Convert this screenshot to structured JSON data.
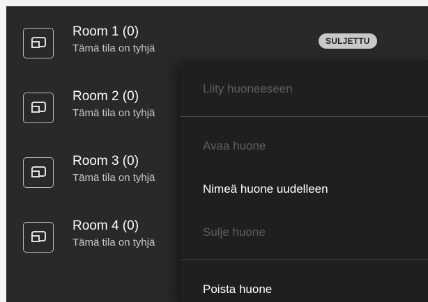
{
  "rooms": [
    {
      "name": "Room 1 (0)",
      "subtitle": "Tämä tila on tyhjä",
      "badge": "SULJETTU"
    },
    {
      "name": "Room 2 (0)",
      "subtitle": "Tämä tila on tyhjä"
    },
    {
      "name": "Room 3 (0)",
      "subtitle": "Tämä tila on tyhjä"
    },
    {
      "name": "Room 4 (0)",
      "subtitle": "Tämä tila on tyhjä"
    }
  ],
  "room_icon": "room-window-icon",
  "context_menu": {
    "items": [
      {
        "label": "Liity huoneeseen",
        "enabled": false
      },
      {
        "label": "Avaa huone",
        "enabled": false
      },
      {
        "label": "Nimeä huone uudelleen",
        "enabled": true
      },
      {
        "label": "Sulje huone",
        "enabled": false
      },
      {
        "label": "Poista huone",
        "enabled": true
      }
    ]
  },
  "colors": {
    "panel_background": "#292929",
    "menu_background": "#1f1f1f",
    "badge_background": "#c9c9c9",
    "disabled_text": "#5f5f5f"
  }
}
